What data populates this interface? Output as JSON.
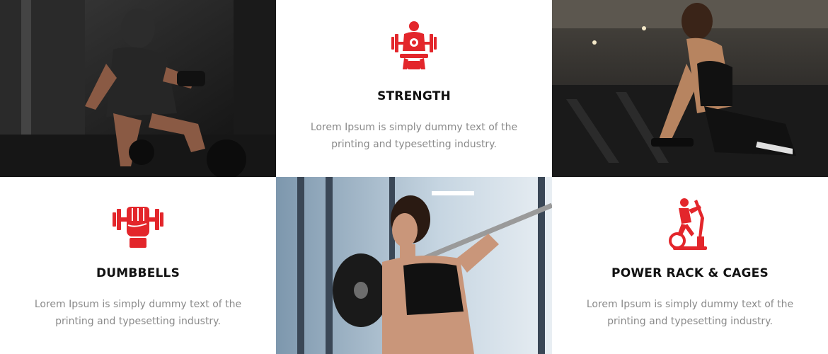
{
  "colors": {
    "accent": "#e3262b",
    "title": "#111111",
    "text": "#8a8a8a"
  },
  "features": [
    {
      "id": "strength",
      "icon": "weight-bench-icon",
      "title": "STRENGTH",
      "description": "Lorem Ipsum is simply dummy text of the printing and typesetting industry."
    },
    {
      "id": "dumbbells",
      "icon": "fist-dumbbell-icon",
      "title": "DUMBBELLS",
      "description": "Lorem Ipsum is simply dummy text of the printing and typesetting industry."
    },
    {
      "id": "power-rack",
      "icon": "elliptical-trainer-icon",
      "title": "POWER RACK & CAGES",
      "description": "Lorem Ipsum is simply dummy text of the printing and typesetting industry."
    }
  ],
  "photos": [
    {
      "id": "man-dumbbell-curl"
    },
    {
      "id": "woman-exercise-bike"
    },
    {
      "id": "woman-barbell-squat"
    }
  ]
}
